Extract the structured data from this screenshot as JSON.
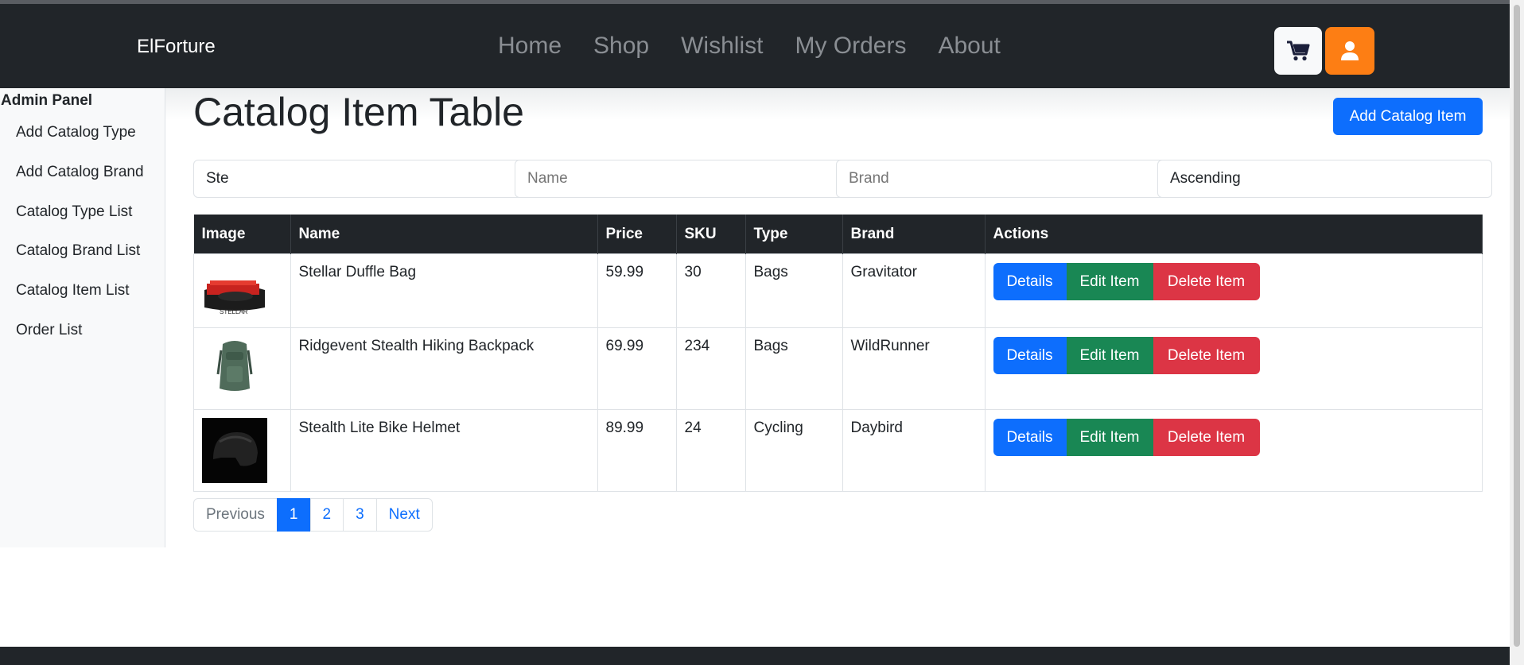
{
  "navbar": {
    "brand": "ElForture",
    "links": [
      "Home",
      "Shop",
      "Wishlist",
      "My Orders",
      "About"
    ],
    "cart_icon": "cart-icon",
    "user_icon": "user-icon"
  },
  "sidebar": {
    "title": "Admin Panel",
    "items": [
      "Add Catalog Type",
      "Add Catalog Brand",
      "Catalog Type List",
      "Catalog Brand List",
      "Catalog Item List",
      "Order List"
    ]
  },
  "main": {
    "title": "Catalog Item Table",
    "add_button": "Add Catalog Item",
    "filters": {
      "search_value": "Ste",
      "name_placeholder": "Name",
      "brand_placeholder": "Brand",
      "sort_value": "Ascending"
    },
    "table": {
      "headers": [
        "Image",
        "Name",
        "Price",
        "SKU",
        "Type",
        "Brand",
        "Actions"
      ],
      "rows": [
        {
          "name": "Stellar Duffle Bag",
          "price": "59.99",
          "sku": "30",
          "type": "Bags",
          "brand": "Gravitator",
          "image": "duffle-bag-image",
          "image_text": "STELLAR"
        },
        {
          "name": "Ridgevent Stealth Hiking Backpack",
          "price": "69.99",
          "sku": "234",
          "type": "Bags",
          "brand": "WildRunner",
          "image": "backpack-image"
        },
        {
          "name": "Stealth Lite Bike Helmet",
          "price": "89.99",
          "sku": "24",
          "type": "Cycling",
          "brand": "Daybird",
          "image": "helmet-image"
        }
      ],
      "actions": {
        "details": "Details",
        "edit": "Edit Item",
        "delete": "Delete Item"
      }
    },
    "pagination": {
      "previous": "Previous",
      "pages": [
        "1",
        "2",
        "3"
      ],
      "active": "1",
      "next": "Next"
    }
  },
  "colors": {
    "primary": "#0d6efd",
    "success": "#198754",
    "danger": "#dc3545",
    "warning": "#fd7e14",
    "dark": "#212529"
  }
}
